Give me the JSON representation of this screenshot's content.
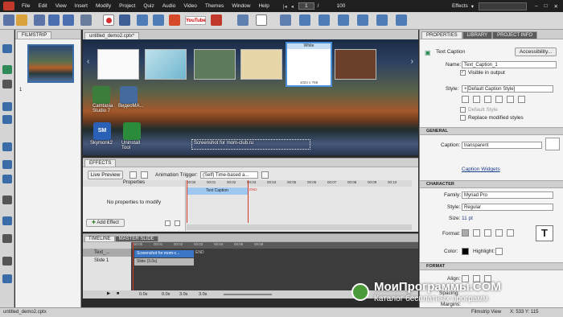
{
  "menubar": {
    "items": [
      "File",
      "Edit",
      "View",
      "Insert",
      "Modify",
      "Project",
      "Quiz",
      "Audio",
      "Video",
      "Themes",
      "Window",
      "Help"
    ],
    "slide_current": "1",
    "slide_separator": "/",
    "slide_total": "100",
    "workspace": "Effects",
    "window_controls": [
      "minimize-icon",
      "maximize-icon",
      "close-icon"
    ]
  },
  "filmstrip": {
    "tab_label": "FILMSTRIP",
    "slide_number": "1"
  },
  "document": {
    "tab_label": "untitled_demo2.cptx*",
    "theme_tooltip_title": "White",
    "theme_tooltip_size": "1024 x 768",
    "desktop_icons": [
      {
        "label": "Camtasia\nStudio 7"
      },
      {
        "label": "BидeoMA..."
      },
      {
        "label": "Skymonk2"
      },
      {
        "label": "Uninstall\nTool"
      }
    ],
    "caption_text": "Screenshot for mom-club.ru"
  },
  "effects": {
    "tab_label": "EFFECTS",
    "live_preview": "Live Preview",
    "animation_trigger_label": "Animation Trigger:",
    "animation_trigger_value": "(Self) Time-based a...",
    "properties_header": "Properties",
    "no_properties": "No properties to modify",
    "add_effect": "Add Effect",
    "track_label": "Text Caption",
    "ruler_marks": [
      "00:00",
      "00:01",
      "00:02",
      "00:03",
      "00:04",
      "00:05",
      "00:06",
      "00:07",
      "00:08",
      "00:09",
      "00:10"
    ],
    "end_label": "END"
  },
  "timeline": {
    "tab_timeline": "TIMELINE",
    "tab_master": "MASTER SLIDE",
    "rows": [
      {
        "name": "Text_...",
        "bar": "Screenshot for mom-c..."
      },
      {
        "name": "Slide 1",
        "bar": "Slide (3.0s)"
      }
    ],
    "end_label": "END",
    "ruler_marks": [
      "00:00",
      "00:01",
      "00:02",
      "00:03",
      "00:04",
      "00:05",
      "00:06"
    ],
    "status_values": [
      "0.0s",
      "0.0s",
      "3.0s",
      "3.0s"
    ]
  },
  "properties": {
    "tabs": [
      "PROPERTIES",
      "LIBRARY",
      "PROJECT INFO"
    ],
    "object_type": "Text Caption",
    "accessibility": "Accessibility...",
    "name_label": "Name:",
    "name_value": "Text_Caption_1",
    "visible_label": "Visible in output",
    "style_label": "Style:",
    "style_value": "+[Default Caption Style]",
    "default_style": "Default Style",
    "replace_styles": "Replace modified styles",
    "general_header": "GENERAL",
    "caption_label": "Caption:",
    "caption_value": "transparent",
    "caption_widgets": "Caption Widgets",
    "character_header": "CHARACTER",
    "family_label": "Family:",
    "family_value": "Myriad Pro",
    "char_style_label": "Style:",
    "char_style_value": "Regular",
    "size_label": "Size:",
    "size_value": "11 pt",
    "format_label": "Format:",
    "color_label": "Color:",
    "highlight_label": "Highlight:",
    "format_header": "FORMAT",
    "align_label": "Align:",
    "spacing_label": "Spacing:",
    "margins_label": "Margins:"
  },
  "statusbar": {
    "file": "untitled_demo2.cptx",
    "view": "Filmstrip View",
    "coords": "X: 533 Y: 115"
  },
  "watermark": {
    "title": "МоиПрограммы.COM",
    "subtitle": "Каталог бесплатных программ"
  },
  "colors": {
    "accent_blue": "#3a6da8",
    "playhead_red": "#d23a2a",
    "selected_track": "#9ec8f0"
  }
}
